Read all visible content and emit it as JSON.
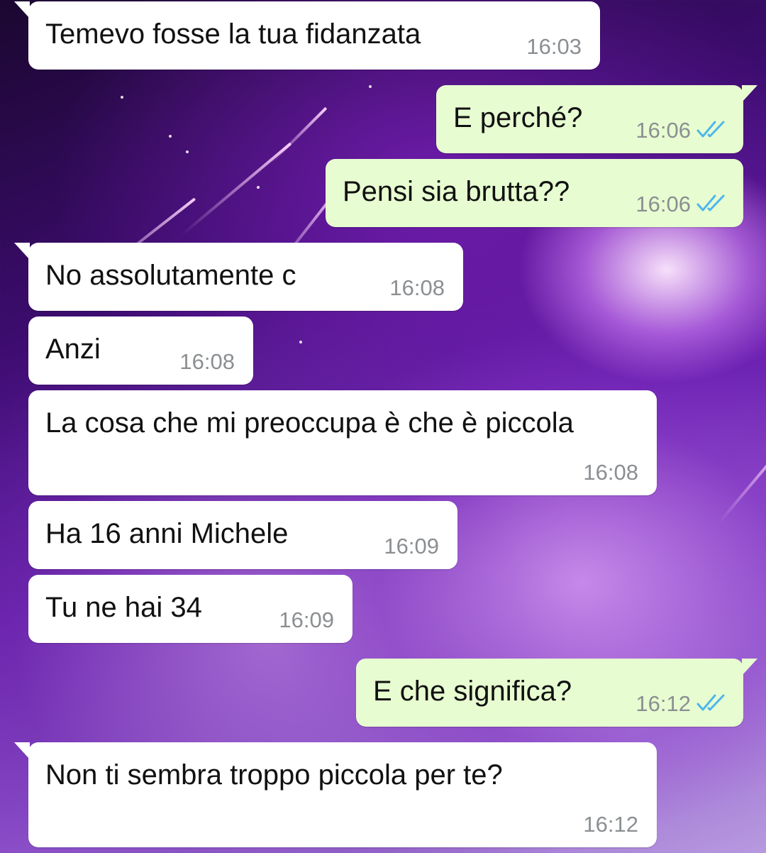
{
  "messages": [
    {
      "text": "Temevo fosse la tua fidanzata",
      "time": "16:03",
      "direction": "incoming"
    },
    {
      "text": "E perché?",
      "time": "16:06",
      "direction": "outgoing",
      "status_icon": "read-double-check-icon"
    },
    {
      "text": "Pensi sia brutta??",
      "time": "16:06",
      "direction": "outgoing",
      "status_icon": "read-double-check-icon"
    },
    {
      "text": "No assolutamente c",
      "time": "16:08",
      "direction": "incoming"
    },
    {
      "text": "Anzi",
      "time": "16:08",
      "direction": "incoming"
    },
    {
      "text": "La cosa che mi preoccupa è che è piccola",
      "time": "16:08",
      "direction": "incoming"
    },
    {
      "text": "Ha 16 anni Michele",
      "time": "16:09",
      "direction": "incoming"
    },
    {
      "text": "Tu ne hai 34",
      "time": "16:09",
      "direction": "incoming"
    },
    {
      "text": "E che significa?",
      "time": "16:12",
      "direction": "outgoing",
      "status_icon": "read-double-check-icon"
    },
    {
      "text": "Non ti sembra troppo piccola per te?",
      "time": "16:12",
      "direction": "incoming"
    }
  ],
  "colors": {
    "incoming_bubble": "#ffffff",
    "outgoing_bubble": "#e7fdd1",
    "read_ticks": "#4fb6ec",
    "timestamp": "#8b8f92"
  }
}
